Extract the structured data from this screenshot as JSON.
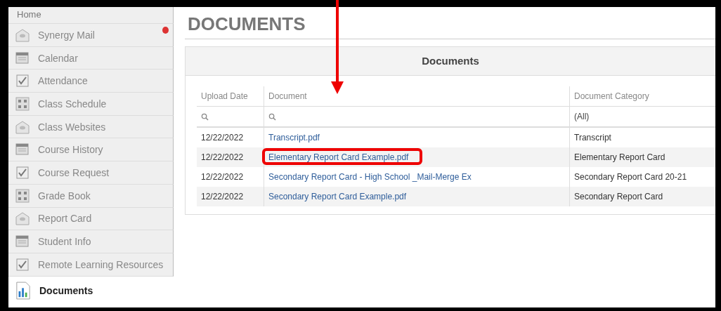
{
  "sidebar": {
    "items": [
      {
        "label": "Home",
        "kind": "header",
        "selected": false
      },
      {
        "label": "Synergy Mail",
        "kind": "item",
        "selected": false,
        "badge": true
      },
      {
        "label": "Calendar",
        "kind": "item",
        "selected": false
      },
      {
        "label": "Attendance",
        "kind": "item",
        "selected": false
      },
      {
        "label": "Class Schedule",
        "kind": "item",
        "selected": false
      },
      {
        "label": "Class Websites",
        "kind": "item",
        "selected": false
      },
      {
        "label": "Course History",
        "kind": "item",
        "selected": false
      },
      {
        "label": "Course Request",
        "kind": "item",
        "selected": false
      },
      {
        "label": "Grade Book",
        "kind": "item",
        "selected": false
      },
      {
        "label": "Report Card",
        "kind": "item",
        "selected": false
      },
      {
        "label": "Student Info",
        "kind": "item",
        "selected": false
      },
      {
        "label": "Remote Learning Resources",
        "kind": "item",
        "selected": false
      },
      {
        "label": "Documents",
        "kind": "item",
        "selected": true
      }
    ]
  },
  "page_title": "DOCUMENTS",
  "panel": {
    "title": "Documents",
    "table": {
      "columns": [
        "Upload Date",
        "Document",
        "Document Category"
      ],
      "filters": [
        {
          "kind": "search"
        },
        {
          "kind": "search"
        },
        {
          "kind": "select",
          "value": "(All)"
        }
      ],
      "rows": [
        {
          "date": "12/22/2022",
          "document": "Transcript.pdf",
          "category": "Transcript",
          "highlighted": false
        },
        {
          "date": "12/22/2022",
          "document": "Elementary Report Card Example.pdf",
          "category": "Elementary Report Card",
          "highlighted": true
        },
        {
          "date": "12/22/2022",
          "document": "Secondary Report Card - High School _Mail-Merge Ex",
          "category": "Secondary Report Card 20-21",
          "highlighted": false
        },
        {
          "date": "12/22/2022",
          "document": "Secondary Report Card Example.pdf",
          "category": "Secondary Report Card",
          "highlighted": false
        }
      ]
    }
  }
}
